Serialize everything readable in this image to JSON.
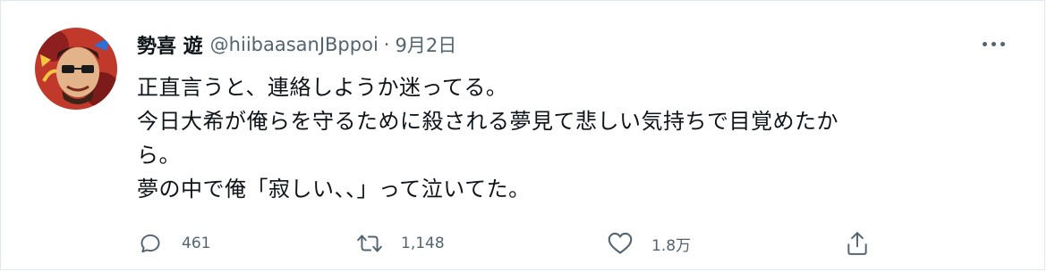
{
  "tweet": {
    "display_name": "勢喜 遊",
    "handle": "@hiibaasanJBppoi",
    "separator": "·",
    "date": "9月2日",
    "text_lines": [
      "正直言うと、連絡しようか迷ってる。",
      "今日大希が俺らを守るために殺される夢見て悲しい気持ちで目覚めたか",
      "ら。",
      "夢の中で俺「寂しい、、」って泣いてた。"
    ],
    "actions": {
      "reply_count": "461",
      "retweet_count": "1,148",
      "like_count": "1.8万"
    }
  },
  "icons": {
    "avatar": "avatar-image",
    "more": "more-dots-icon",
    "reply": "reply-icon",
    "retweet": "retweet-icon",
    "like": "heart-icon",
    "share": "share-icon"
  },
  "colors": {
    "text_primary": "#0f1419",
    "text_secondary": "#536471",
    "border": "#e1e8ed",
    "avatar_bg": "#c0392b"
  }
}
